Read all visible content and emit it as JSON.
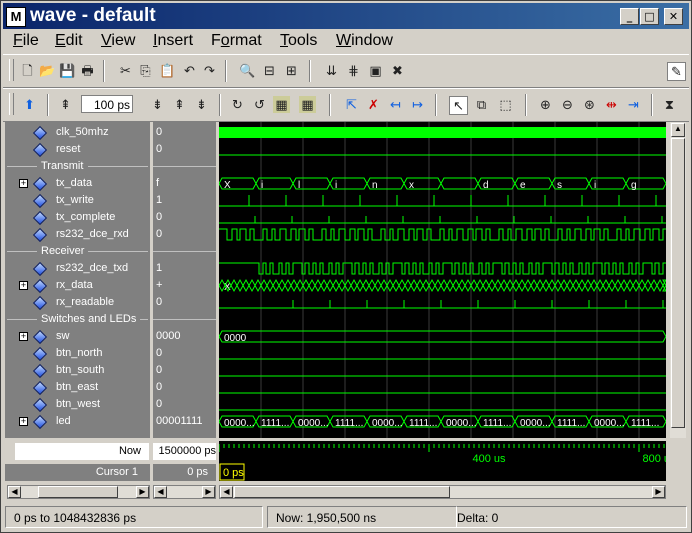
{
  "window": {
    "title": "wave - default",
    "app_icon": "M",
    "controls": {
      "minimize": "_",
      "maximize": "□",
      "close": "✕"
    }
  },
  "menu": [
    {
      "label": "File",
      "accel": "F"
    },
    {
      "label": "Edit",
      "accel": "E"
    },
    {
      "label": "View",
      "accel": "V"
    },
    {
      "label": "Insert",
      "accel": "I"
    },
    {
      "label": "Format",
      "accel": "o"
    },
    {
      "label": "Tools",
      "accel": "T"
    },
    {
      "label": "Window",
      "accel": "W"
    }
  ],
  "toolbar2": {
    "zoom_value": "100 ps"
  },
  "signals": [
    {
      "kind": "signal",
      "name": "clk_50mhz",
      "value": "0",
      "expandable": false
    },
    {
      "kind": "signal",
      "name": "reset",
      "value": "0",
      "expandable": false
    },
    {
      "kind": "group",
      "name": "Transmit"
    },
    {
      "kind": "signal",
      "name": "tx_data",
      "value": "f",
      "expandable": true
    },
    {
      "kind": "signal",
      "name": "tx_write",
      "value": "1",
      "expandable": false
    },
    {
      "kind": "signal",
      "name": "tx_complete",
      "value": "0",
      "expandable": false
    },
    {
      "kind": "signal",
      "name": "rs232_dce_rxd",
      "value": "0",
      "expandable": false
    },
    {
      "kind": "group",
      "name": "Receiver"
    },
    {
      "kind": "signal",
      "name": "rs232_dce_txd",
      "value": "1",
      "expandable": false
    },
    {
      "kind": "signal",
      "name": "rx_data",
      "value": "+",
      "expandable": true
    },
    {
      "kind": "signal",
      "name": "rx_readable",
      "value": "0",
      "expandable": false
    },
    {
      "kind": "group",
      "name": "Switches and LEDs"
    },
    {
      "kind": "signal",
      "name": "sw",
      "value": "0000",
      "expandable": true
    },
    {
      "kind": "signal",
      "name": "btn_north",
      "value": "0",
      "expandable": false
    },
    {
      "kind": "signal",
      "name": "btn_south",
      "value": "0",
      "expandable": false
    },
    {
      "kind": "signal",
      "name": "btn_east",
      "value": "0",
      "expandable": false
    },
    {
      "kind": "signal",
      "name": "btn_west",
      "value": "0",
      "expandable": false
    },
    {
      "kind": "signal",
      "name": "led",
      "value": "00001111",
      "expandable": true
    }
  ],
  "waves": {
    "tx_data_labels": [
      "X",
      "i",
      "l",
      "i",
      "n",
      "x",
      "",
      "d",
      "e",
      "s",
      "i",
      "g"
    ],
    "sw_label": "0000",
    "led_labels": [
      "0000...",
      "1111...",
      "0000...",
      "1111...",
      "0000...",
      "1111...",
      "0000...",
      "1111...",
      "0000...",
      "1111...",
      "0000...",
      "1111..."
    ],
    "rx_data_label": "X"
  },
  "timeline": {
    "now_label": "Now",
    "now_value": "1500000 ps",
    "cursor_label": "Cursor 1",
    "cursor_value": "0 ps",
    "cursor_marker": "0 ps",
    "ticks": [
      "400 us",
      "800 us"
    ]
  },
  "status": {
    "range": "0 ps to 1048432836 ps",
    "now": "Now: 1,950,500 ns",
    "delta": "Delta: 0"
  },
  "colors": {
    "wave": "#00ff00",
    "background": "#000000",
    "grid": "#3a3a3a",
    "cursor": "#ffff00"
  }
}
